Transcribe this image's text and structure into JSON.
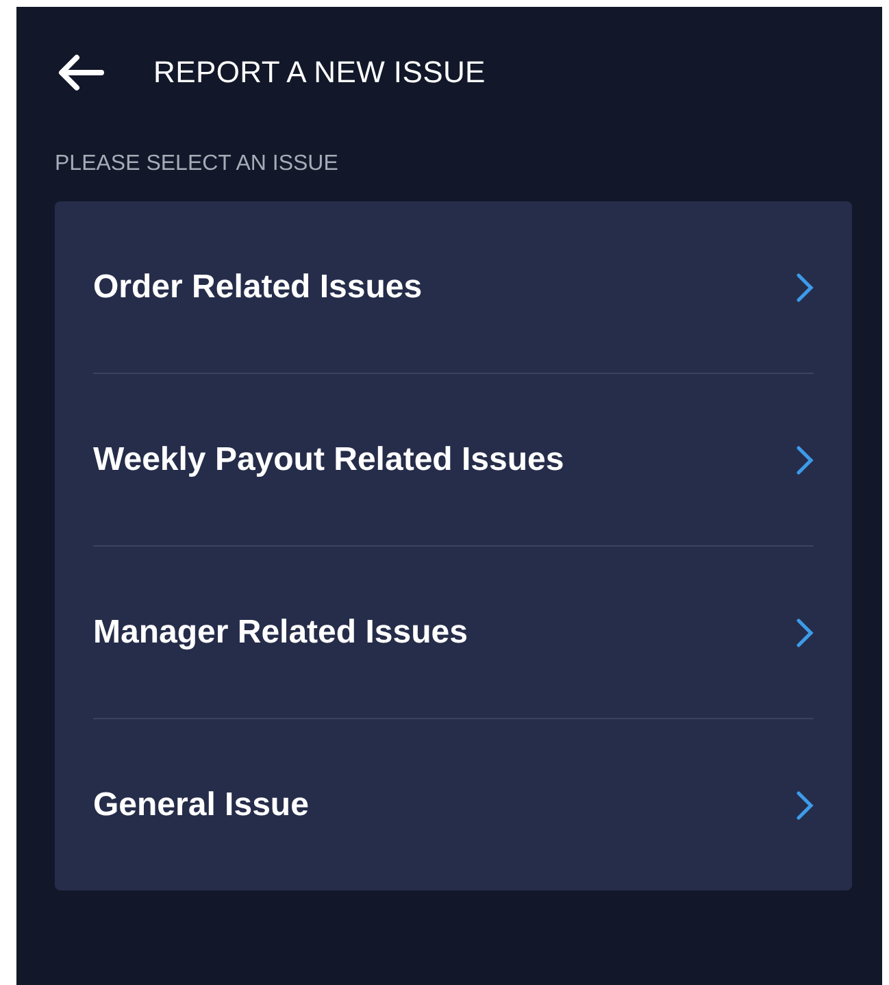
{
  "header": {
    "title": "REPORT A NEW ISSUE"
  },
  "section_label": "PLEASE SELECT AN ISSUE",
  "issues": [
    {
      "label": "Order Related Issues"
    },
    {
      "label": "Weekly Payout Related Issues"
    },
    {
      "label": "Manager Related Issues"
    },
    {
      "label": "General Issue"
    }
  ]
}
